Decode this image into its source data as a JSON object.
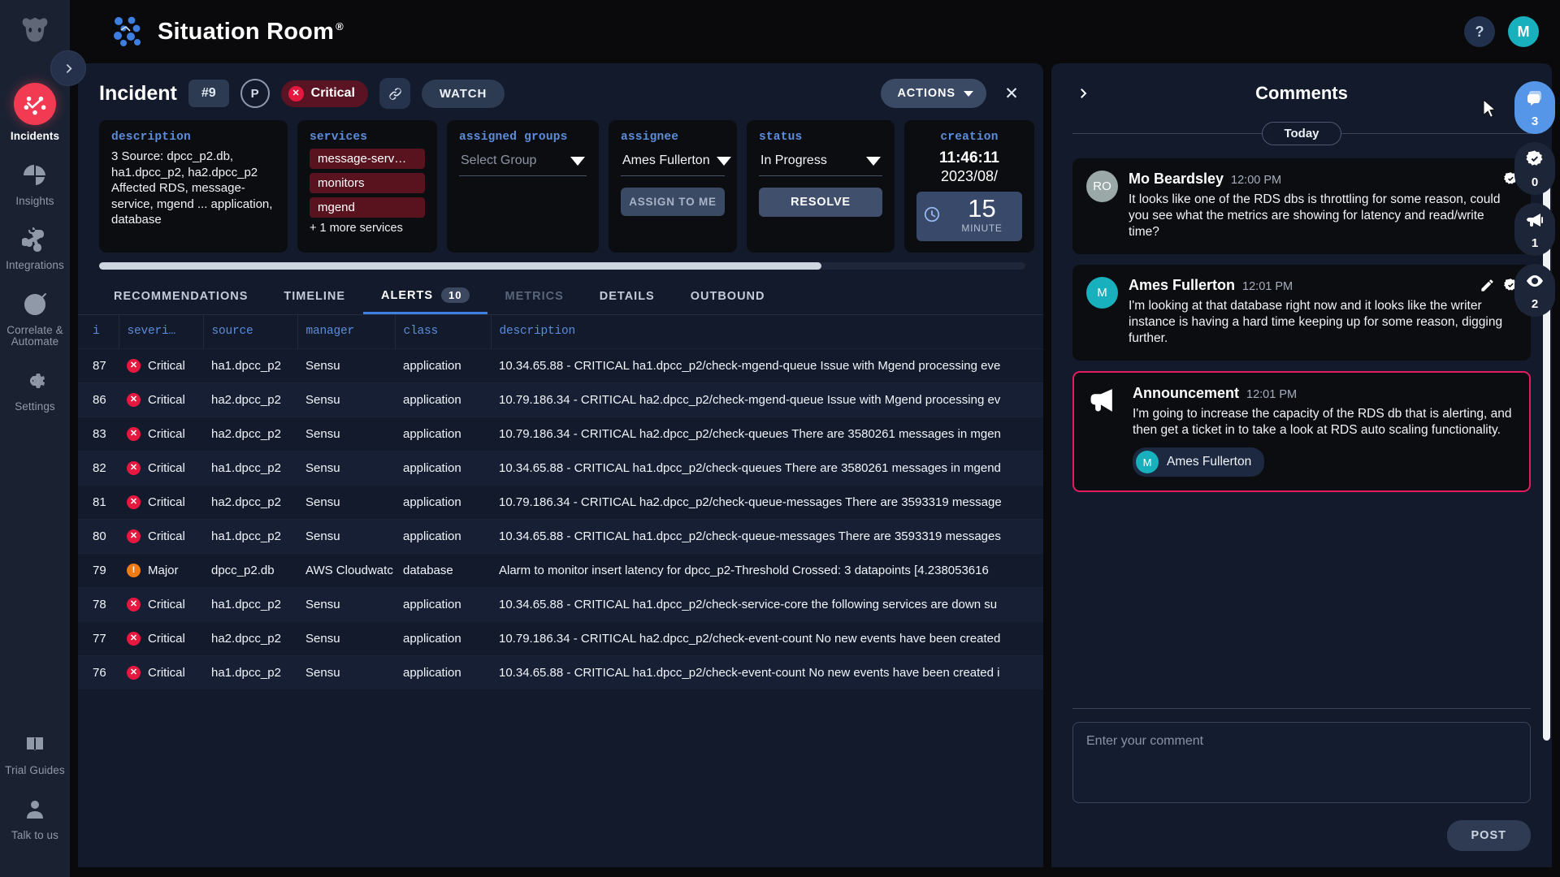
{
  "app": {
    "brand_title": "Situation Room",
    "brand_sup": "®",
    "help_label": "?",
    "user_initial": "M"
  },
  "left_rail": {
    "expand_icon": "chevron-right-icon",
    "items": [
      {
        "label": "Incidents",
        "icon": "incidents-icon",
        "active": true
      },
      {
        "label": "Insights",
        "icon": "pie-chart-icon",
        "active": false
      },
      {
        "label": "Integrations",
        "icon": "integrations-icon",
        "active": false
      },
      {
        "label": "Correlate & Automate",
        "icon": "target-icon",
        "active": false
      },
      {
        "label": "Settings",
        "icon": "gear-icon",
        "active": false
      }
    ],
    "bottom_items": [
      {
        "label": "Trial Guides",
        "icon": "guides-icon"
      },
      {
        "label": "Talk to us",
        "icon": "person-icon"
      }
    ]
  },
  "incident": {
    "title": "Incident",
    "number": "#9",
    "priority": "P",
    "severity_label": "Critical",
    "link_icon": "link-icon",
    "watch_label": "WATCH",
    "actions_label": "ACTIONS",
    "close_icon": "close-icon",
    "description": {
      "label": "description",
      "value": "3 Source: dpcc_p2.db, ha1.dpcc_p2, ha2.dpcc_p2 Affected RDS, message-service, mgend ... application, database"
    },
    "services": {
      "label": "services",
      "chips": [
        "message-serv…",
        "monitors",
        "mgend"
      ],
      "more": "+ 1 more services"
    },
    "assigned_groups": {
      "label": "assigned groups",
      "value": "Select Group",
      "is_placeholder": true
    },
    "assignee": {
      "label": "assignee",
      "value": "Ames Fullerton",
      "button": "ASSIGN TO ME"
    },
    "status": {
      "label": "status",
      "value": "In Progress",
      "button": "RESOLVE"
    },
    "creation": {
      "label": "creation",
      "time": "11:46:11",
      "date": "2023/08/",
      "age_number": "15",
      "age_unit": "MINUTE"
    }
  },
  "tabs": [
    {
      "label": "RECOMMENDATIONS",
      "active": false,
      "dim": false
    },
    {
      "label": "TIMELINE",
      "active": false,
      "dim": false
    },
    {
      "label": "ALERTS",
      "active": true,
      "dim": false,
      "count": "10"
    },
    {
      "label": "METRICS",
      "active": false,
      "dim": true
    },
    {
      "label": "DETAILS",
      "active": false,
      "dim": false
    },
    {
      "label": "OUTBOUND",
      "active": false,
      "dim": false
    }
  ],
  "alerts_table": {
    "columns": [
      "i",
      "severi…",
      "source",
      "manager",
      "class",
      "description"
    ],
    "rows": [
      {
        "i": "87",
        "severity": "Critical",
        "sev_kind": "critical",
        "source": "ha1.dpcc_p2",
        "manager": "Sensu",
        "class": "application",
        "description": "10.34.65.88 - CRITICAL ha1.dpcc_p2/check-mgend-queue Issue with Mgend processing eve"
      },
      {
        "i": "86",
        "severity": "Critical",
        "sev_kind": "critical",
        "source": "ha2.dpcc_p2",
        "manager": "Sensu",
        "class": "application",
        "description": "10.79.186.34 - CRITICAL ha2.dpcc_p2/check-mgend-queue Issue with Mgend processing ev"
      },
      {
        "i": "83",
        "severity": "Critical",
        "sev_kind": "critical",
        "source": "ha2.dpcc_p2",
        "manager": "Sensu",
        "class": "application",
        "description": "10.79.186.34 - CRITICAL ha2.dpcc_p2/check-queues There are 3580261 messages in mgen"
      },
      {
        "i": "82",
        "severity": "Critical",
        "sev_kind": "critical",
        "source": "ha1.dpcc_p2",
        "manager": "Sensu",
        "class": "application",
        "description": "10.34.65.88 - CRITICAL ha1.dpcc_p2/check-queues There are 3580261 messages in mgend"
      },
      {
        "i": "81",
        "severity": "Critical",
        "sev_kind": "critical",
        "source": "ha2.dpcc_p2",
        "manager": "Sensu",
        "class": "application",
        "description": "10.79.186.34 - CRITICAL ha2.dpcc_p2/check-queue-messages There are 3593319 message"
      },
      {
        "i": "80",
        "severity": "Critical",
        "sev_kind": "critical",
        "source": "ha1.dpcc_p2",
        "manager": "Sensu",
        "class": "application",
        "description": "10.34.65.88 - CRITICAL ha1.dpcc_p2/check-queue-messages There are 3593319 messages"
      },
      {
        "i": "79",
        "severity": "Major",
        "sev_kind": "major",
        "source": "dpcc_p2.db",
        "manager": "AWS Cloudwatc",
        "class": "database",
        "description": "Alarm to monitor insert latency for dpcc_p2-Threshold Crossed: 3 datapoints [4.238053616"
      },
      {
        "i": "78",
        "severity": "Critical",
        "sev_kind": "critical",
        "source": "ha1.dpcc_p2",
        "manager": "Sensu",
        "class": "application",
        "description": "10.34.65.88 - CRITICAL ha1.dpcc_p2/check-service-core the following services are down su"
      },
      {
        "i": "77",
        "severity": "Critical",
        "sev_kind": "critical",
        "source": "ha2.dpcc_p2",
        "manager": "Sensu",
        "class": "application",
        "description": "10.79.186.34 - CRITICAL ha2.dpcc_p2/check-event-count No new events have been created"
      },
      {
        "i": "76",
        "severity": "Critical",
        "sev_kind": "critical",
        "source": "ha1.dpcc_p2",
        "manager": "Sensu",
        "class": "application",
        "description": "10.34.65.88 - CRITICAL ha1.dpcc_p2/check-event-count No new events have been created i"
      }
    ]
  },
  "comments": {
    "title": "Comments",
    "collapse_icon": "chevron-right-icon",
    "day_label": "Today",
    "items": [
      {
        "type": "comment",
        "avatar_initials": "RO",
        "avatar_color": "#9aa9a8",
        "name": "Mo Beardsley",
        "time": "12:00 PM",
        "text": "It looks like one of the RDS dbs is throttling for some reason, could you see what the metrics are showing for latency and read/write time?",
        "has_edit": false,
        "has_verify": true
      },
      {
        "type": "comment",
        "avatar_initials": "M",
        "avatar_color": "#18b0bd",
        "name": "Ames Fullerton",
        "time": "12:01 PM",
        "text": "I'm looking at that database right now and it looks like the writer instance is having a hard time keeping up for some reason, digging further.",
        "has_edit": true,
        "has_verify": true
      },
      {
        "type": "announcement",
        "name": "Announcement",
        "time": "12:01 PM",
        "text": "I'm going to increase the capacity of the RDS db that is alerting, and then get a ticket in to take a look at RDS auto scaling functionality.",
        "author_initials": "M",
        "author_color": "#18b0bd",
        "author_name": "Ames Fullerton"
      }
    ],
    "input_placeholder": "Enter your comment",
    "input_value": "",
    "post_label": "POST"
  },
  "right_rail": [
    {
      "icon": "comments-icon",
      "count": "3",
      "active": true
    },
    {
      "icon": "verified-icon",
      "count": "0",
      "active": false
    },
    {
      "icon": "megaphone-icon",
      "count": "1",
      "active": false
    },
    {
      "icon": "eye-icon",
      "count": "2",
      "active": false
    }
  ],
  "colors": {
    "accent_blue": "#5596e8",
    "critical_red": "#e5193f",
    "major_orange": "#ef7b12",
    "announce_border": "#e31c5f",
    "panel_bg": "#121a2b",
    "card_bg": "#0c0d11"
  }
}
